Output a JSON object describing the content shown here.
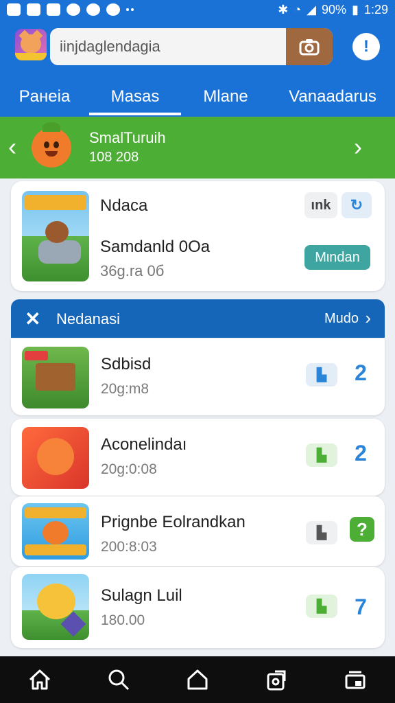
{
  "status_bar": {
    "time": "1:29",
    "battery": "90%",
    "left_icons": [
      "gallery-icon",
      "app-icon",
      "notification-icon",
      "cat-icon",
      "dot-icon",
      "sync-icon",
      "more-dots-icon"
    ],
    "right_icons": [
      "bluetooth-icon",
      "wifi-icon",
      "signal-icon",
      "battery-icon"
    ]
  },
  "header": {
    "search_value": "iinjdaglendagia",
    "camera_icon": "camera-icon",
    "info_icon": "info-icon",
    "tabs": [
      {
        "label": "Paнeia",
        "active": false
      },
      {
        "label": "Masas",
        "active": true
      },
      {
        "label": "Mlane",
        "active": false
      },
      {
        "label": "Vanaadarus",
        "active": false
      }
    ]
  },
  "banner": {
    "title": "SmalTuruih",
    "subtitle": "108 208",
    "color": "#4cae35"
  },
  "featured": {
    "name": "Ndaca",
    "subtitle": "Samdanld 0Oa",
    "meta": "36g.ra 0б",
    "tag": "ιnk",
    "action_label": "Mιndan"
  },
  "section": {
    "title": "Nedanasi",
    "more_label": "Mudo"
  },
  "list": [
    {
      "name": "Sdbisd",
      "meta": "20g:m8",
      "badge": "book-icon",
      "num": "2",
      "num_style": "plain",
      "badge_color": "#e3edf7"
    },
    {
      "name": "Aconelindaı",
      "meta": "20g:0:08",
      "badge": "book-icon",
      "num": "2",
      "num_style": "plain",
      "badge_color": "#e2f3dd"
    },
    {
      "name": "Prignbe Eolrandkan",
      "meta": "200:8:03",
      "badge": "book-icon",
      "num": "?",
      "num_style": "boxed",
      "badge_color": "#eef0f2"
    },
    {
      "name": "Sulagn Luil",
      "meta": "180.00",
      "badge": "book-icon",
      "num": "7",
      "num_style": "plain",
      "badge_color": "#e2f3dd"
    }
  ],
  "bottom_nav": [
    "home-icon",
    "search-icon",
    "house-icon",
    "share-icon",
    "window-icon"
  ],
  "colors": {
    "primary": "#1a72d6",
    "section": "#1565b8",
    "accent_green": "#4cae35",
    "teal": "#3ea5a0"
  }
}
